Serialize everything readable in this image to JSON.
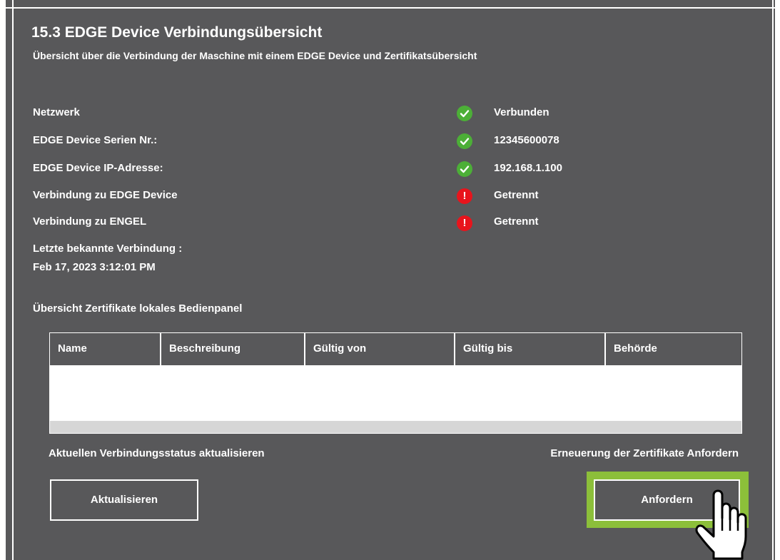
{
  "header": {
    "title": "15.3 EDGE Device Verbindungsübersicht",
    "subtitle": "Übersicht über die Verbindung der Maschine mit einem EDGE Device und Zertifikatsübersicht"
  },
  "status_rows": [
    {
      "label": "Netzwerk",
      "icon": "check-icon",
      "status_color": "#4caf37",
      "value": "Verbunden"
    },
    {
      "label": "EDGE Device Serien Nr.:",
      "icon": "check-icon",
      "status_color": "#4caf37",
      "value": "12345600078"
    },
    {
      "label": "EDGE Device IP-Adresse:",
      "icon": "check-icon",
      "status_color": "#4caf37",
      "value": "192.168.1.100"
    },
    {
      "label": "Verbindung zu EDGE Device",
      "icon": "error-icon",
      "status_color": "#e8141c",
      "value": "Getrennt"
    },
    {
      "label": "Verbindung zu ENGEL",
      "icon": "error-icon",
      "status_color": "#e8141c",
      "value": "Getrennt"
    }
  ],
  "last_connection": {
    "label": "Letzte bekannte Verbindung :",
    "value": "Feb 17, 2023 3:12:01 PM"
  },
  "certificates": {
    "heading": "Übersicht Zertifikate lokales Bedienpanel",
    "columns": [
      "Name",
      "Beschreibung",
      "Gültig von",
      "Gültig bis",
      "Behörde"
    ],
    "rows": []
  },
  "actions": {
    "refresh_caption": "Aktuellen Verbindungsstatus aktualisieren",
    "refresh_button": "Aktualisieren",
    "request_caption": "Erneuerung der Zertifikate Anfordern",
    "request_button": "Anfordern"
  },
  "colors": {
    "panel_bg": "#58585a",
    "highlight": "#8cbf3a",
    "ok": "#4caf37",
    "error": "#e8141c"
  }
}
